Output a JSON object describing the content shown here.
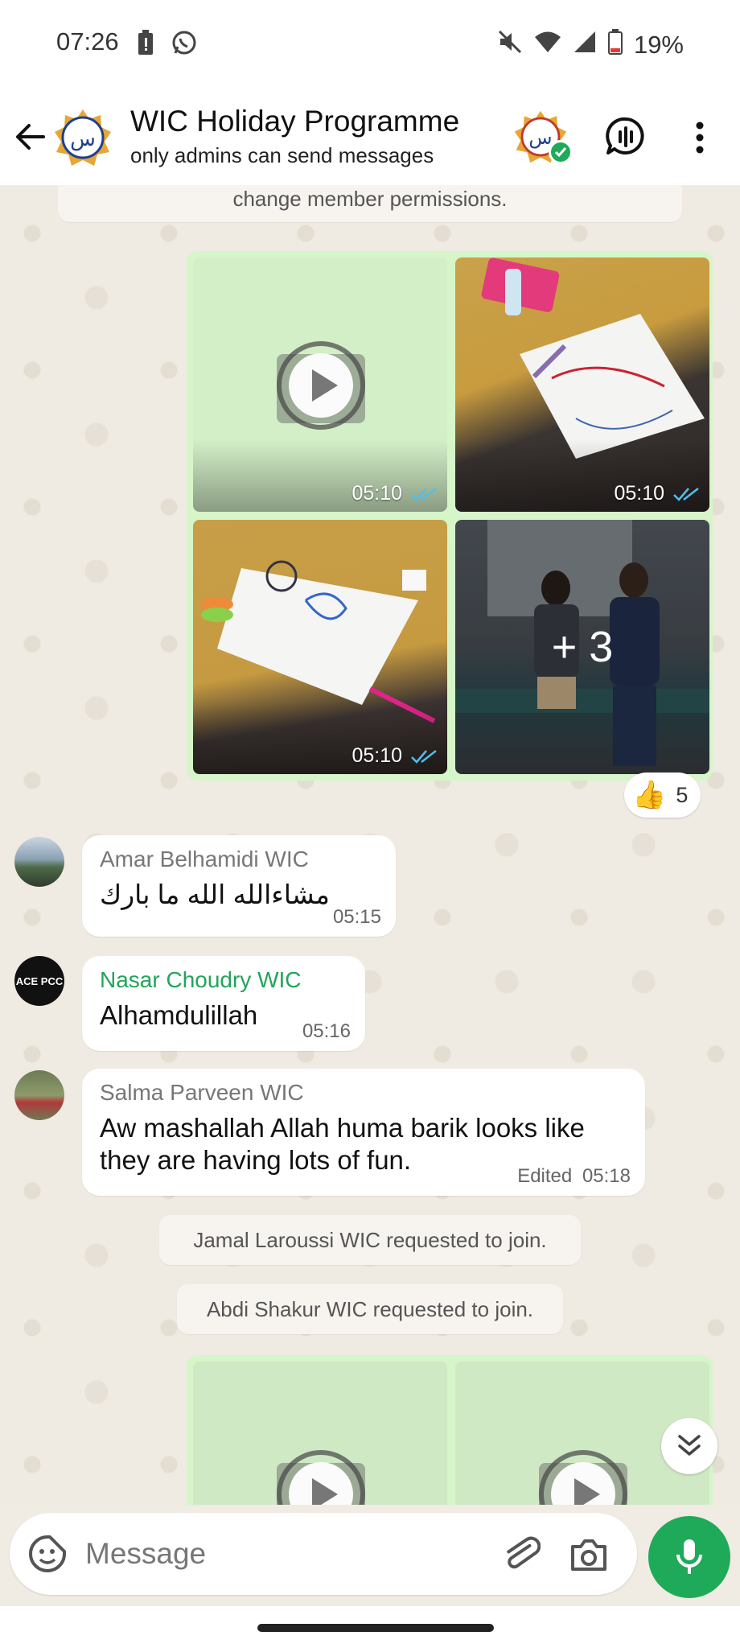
{
  "status_bar": {
    "time": "07:26",
    "battery": "19%",
    "icons_left": [
      "battery-alert-icon",
      "whatsapp-icon"
    ],
    "icons_right": [
      "mute-icon",
      "wifi-icon",
      "signal-icon",
      "battery-icon"
    ]
  },
  "header": {
    "title": "WIC Holiday Programme",
    "subtitle": "only admins can send messages",
    "avatar_glyph": "ﺱ"
  },
  "chat": {
    "top_notice": "change member permissions.",
    "media_group_1": {
      "tiles": [
        {
          "type": "video",
          "time": "05:10"
        },
        {
          "type": "photo",
          "time": "05:10"
        },
        {
          "type": "photo",
          "time": "05:10"
        },
        {
          "type": "photo",
          "more": "+ 3"
        }
      ],
      "reaction": {
        "emoji": "👍",
        "count": "5"
      }
    },
    "messages": [
      {
        "sender": "Amar Belhamidi WIC",
        "text": "مشاءالله الله ما بارك",
        "time": "05:15",
        "edited": ""
      },
      {
        "sender": "Nasar Choudry WIC",
        "text": "Alhamdulillah",
        "time": "05:16",
        "edited": ""
      },
      {
        "sender": "Salma Parveen WIC",
        "text": "Aw mashallah Allah huma barik looks like they are having lots of fun.",
        "time": "05:18",
        "edited": "Edited"
      }
    ],
    "avatar_text_2": "ACE PCC",
    "system_notices": [
      "Jamal Laroussi WIC requested to join.",
      "Abdi Shakur WIC requested to join."
    ]
  },
  "composer": {
    "placeholder": "Message"
  },
  "colors": {
    "accent_green": "#1faa59",
    "outgoing_bubble": "#d6f5c9",
    "sender_green": "#20a55a",
    "chat_bg": "#efeae2"
  }
}
